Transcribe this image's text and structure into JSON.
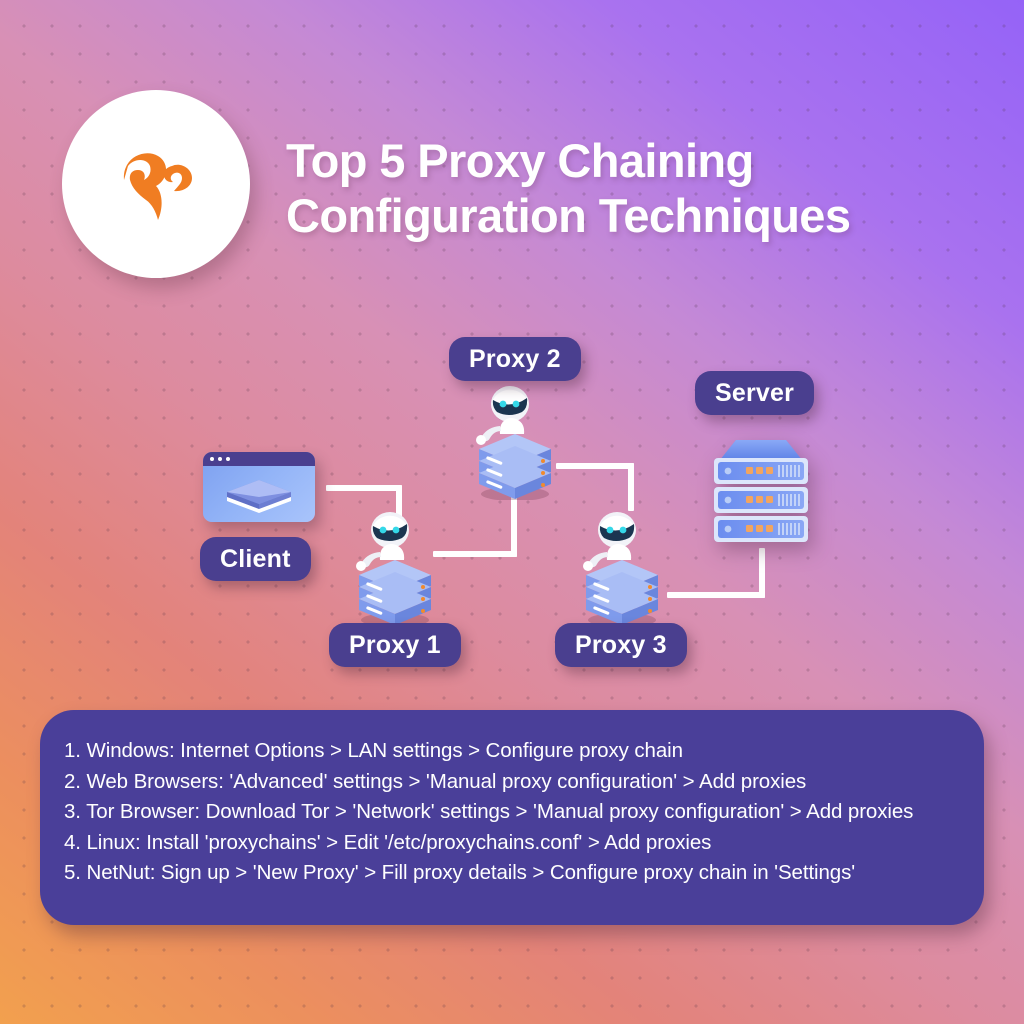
{
  "header": {
    "logo_icon": "netnut-squirrel-logo-icon",
    "logo_color": "#f07d22",
    "title_line1": "Top 5 Proxy Chaining",
    "title_line2": "Configuration Techniques"
  },
  "colors": {
    "pill_bg": "#4a3f8f",
    "panel_bg": "#4a3f99",
    "connector": "#ffffff",
    "bg_orange": "#f2a04e",
    "bg_pink": "#dd8b9e",
    "bg_purple": "#9563f7",
    "text_on_dark": "#ffffff"
  },
  "diagram": {
    "nodes": [
      {
        "id": "client",
        "label": "Client",
        "icon": "browser-window-icon"
      },
      {
        "id": "proxy1",
        "label": "Proxy 1",
        "icon": "robot-on-server-stack-icon"
      },
      {
        "id": "proxy2",
        "label": "Proxy 2",
        "icon": "robot-on-server-stack-icon"
      },
      {
        "id": "proxy3",
        "label": "Proxy 3",
        "icon": "robot-on-server-stack-icon"
      },
      {
        "id": "server",
        "label": "Server",
        "icon": "server-rack-icon"
      }
    ],
    "connections": [
      {
        "from": "client",
        "to": "proxy1"
      },
      {
        "from": "proxy1",
        "to": "proxy2"
      },
      {
        "from": "proxy2",
        "to": "proxy3"
      },
      {
        "from": "proxy3",
        "to": "server"
      }
    ]
  },
  "steps": [
    "1. Windows: Internet Options > LAN settings > Configure proxy chain",
    "2. Web Browsers: 'Advanced' settings > 'Manual proxy configuration' > Add proxies",
    "3. Tor Browser: Download Tor > 'Network' settings > 'Manual proxy configuration' > Add proxies",
    "4. Linux: Install 'proxychains' > Edit '/etc/proxychains.conf' > Add proxies",
    "5. NetNut: Sign up > 'New Proxy' > Fill proxy details > Configure proxy chain in 'Settings'"
  ]
}
